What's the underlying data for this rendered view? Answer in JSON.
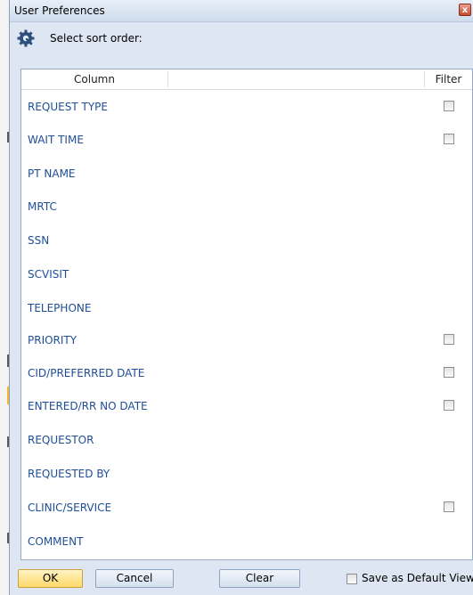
{
  "window": {
    "title": "User Preferences",
    "close_glyph": "x",
    "header_text": "Select sort order:"
  },
  "table": {
    "column_header": "Column",
    "filter_header": "Filter",
    "rows": [
      {
        "label": "REQUEST TYPE",
        "has_filter": true,
        "filter_checked": false
      },
      {
        "label": "WAIT TIME",
        "has_filter": true,
        "filter_checked": false
      },
      {
        "label": "PT NAME",
        "has_filter": false
      },
      {
        "label": "MRTC",
        "has_filter": false
      },
      {
        "label": "SSN",
        "has_filter": false
      },
      {
        "label": "SCVISIT",
        "has_filter": false
      },
      {
        "label": "TELEPHONE",
        "has_filter": false
      },
      {
        "label": "PRIORITY",
        "has_filter": true,
        "filter_checked": false
      },
      {
        "label": "CID/PREFERRED DATE",
        "has_filter": true,
        "filter_checked": false
      },
      {
        "label": "ENTERED/RR NO DATE",
        "has_filter": true,
        "filter_checked": false
      },
      {
        "label": "REQUESTOR",
        "has_filter": false
      },
      {
        "label": "REQUESTED BY",
        "has_filter": false
      },
      {
        "label": "CLINIC/SERVICE",
        "has_filter": true,
        "filter_checked": false
      },
      {
        "label": "COMMENT",
        "has_filter": false
      }
    ]
  },
  "footer": {
    "ok_label": "OK",
    "cancel_label": "Cancel",
    "clear_label": "Clear",
    "default_view_label": "Save as Default View",
    "default_view_checked": false
  },
  "icons": {
    "header_icon": "gear-icon",
    "close_icon": "close-icon"
  },
  "colors": {
    "row_text": "#1f4e96",
    "ok_button": "#ffd86a",
    "dialog_background": "#dde6f2"
  }
}
